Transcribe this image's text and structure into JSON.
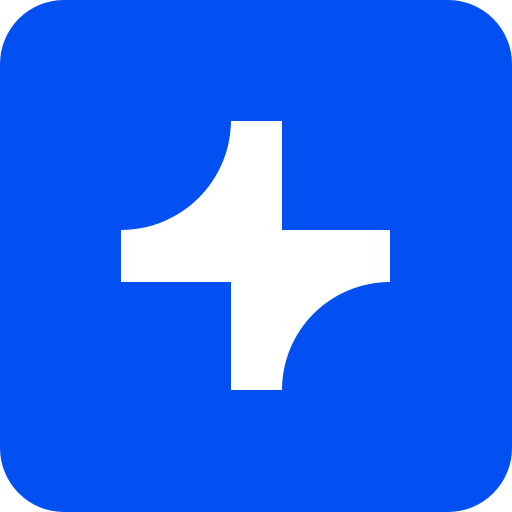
{
  "app_icon": {
    "background_color": "#0350F2",
    "glyph_color": "#FFFFFF",
    "glyph_icon": "spark-plus-icon"
  }
}
